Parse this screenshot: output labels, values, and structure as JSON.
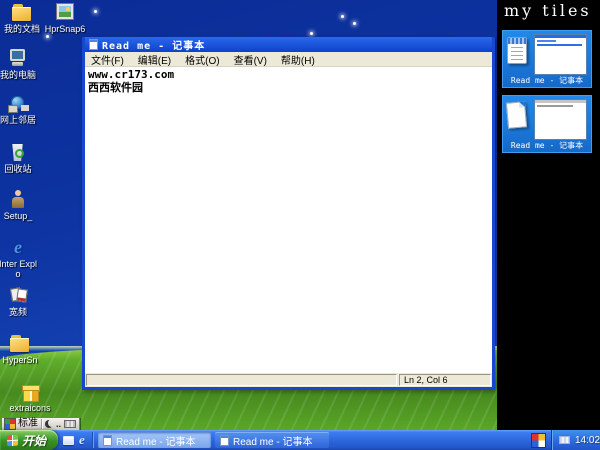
{
  "desktop": {
    "icons": [
      {
        "label": "我的文档"
      },
      {
        "label": "HprSnap6"
      },
      {
        "label": "我的电脑"
      },
      {
        "label": "网上邻居"
      },
      {
        "label": "回收站"
      },
      {
        "label": "Setup_"
      },
      {
        "label": "Inter Explo"
      },
      {
        "label": "宽频"
      },
      {
        "label": "HyperSn"
      },
      {
        "label": "extraicons"
      }
    ]
  },
  "notepad": {
    "title": "Read me - 记事本",
    "menu_items": [
      "文件(F)",
      "编辑(E)",
      "格式(O)",
      "查看(V)",
      "帮助(H)"
    ],
    "lines": [
      "www.cr173.com",
      "西西软件园"
    ],
    "status_lncol": "Ln 2, Col 6"
  },
  "tiles_panel": {
    "heading": "my tiles",
    "tiles": [
      {
        "label": "Read me - 记事本"
      },
      {
        "label": "Read me - 记事本"
      }
    ]
  },
  "language_bar": {
    "standard_label": "标准",
    "punctuation_label": ".."
  },
  "taskbar": {
    "start_label": "开始",
    "task_buttons": [
      {
        "label": "Read me - 记事本"
      },
      {
        "label": "Read me - 记事本"
      }
    ],
    "clock": "14:02"
  },
  "colors": {
    "desktop_blue": "#0b2c96",
    "grass_green": "#5fae2b",
    "titlebar_blue": "#1350dc",
    "tile_blue": "#1c7fe0",
    "taskbar_blue": "#2a63d8",
    "start_green": "#389024",
    "panel_black": "#000000"
  }
}
